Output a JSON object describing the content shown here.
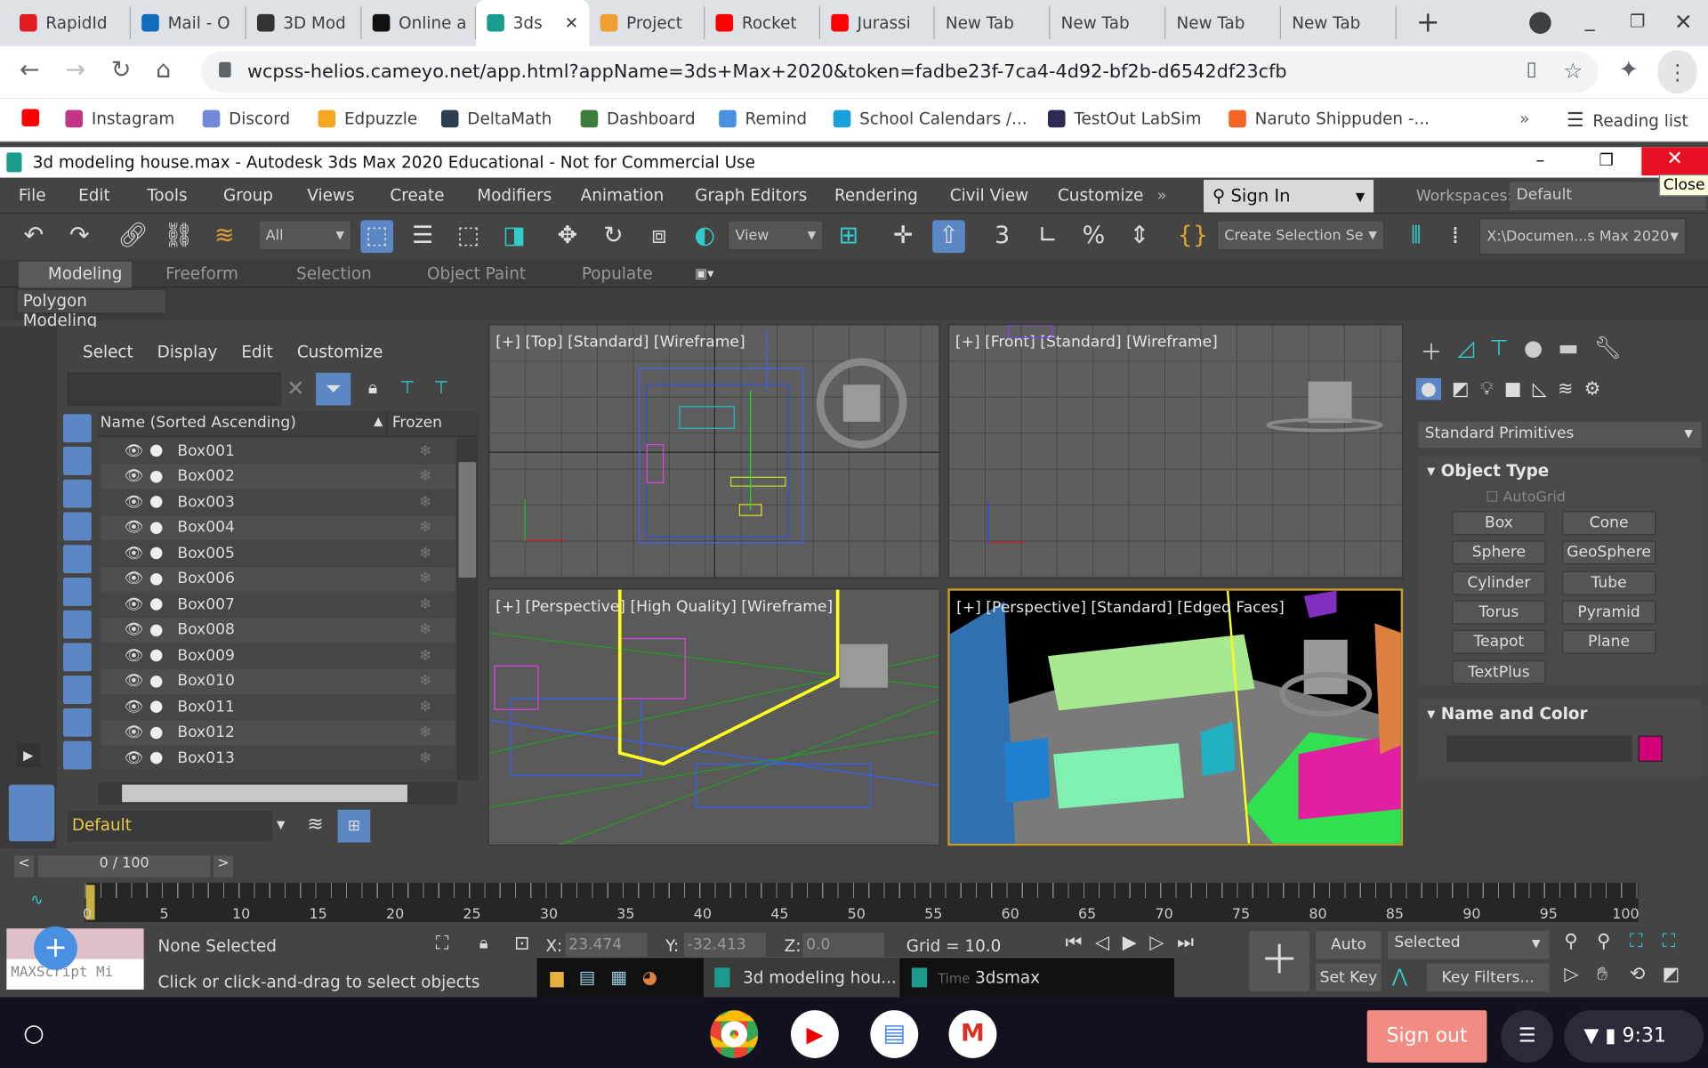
{
  "browser": {
    "tabs": [
      {
        "label": "RapidId",
        "color": "#e01b22"
      },
      {
        "label": "Mail - O",
        "color": "#0f6cbd"
      },
      {
        "label": "3D Mod",
        "color": "#333"
      },
      {
        "label": "Online a",
        "color": "#111"
      },
      {
        "label": "3ds",
        "color": "#1a9c8c",
        "active": true
      },
      {
        "label": "Project",
        "color": "#f0a030"
      },
      {
        "label": "Rocket",
        "color": "#ff0000"
      },
      {
        "label": "Jurassi",
        "color": "#ff0000"
      },
      {
        "label": "New Tab"
      },
      {
        "label": "New Tab"
      },
      {
        "label": "New Tab"
      },
      {
        "label": "New Tab"
      }
    ],
    "url": "wcpss-helios.cameyo.net/app.html?appName=3ds+Max+2020&token=fadbe23f-7ca4-4d92-bf2b-d6542df23cfb",
    "bookmarks": [
      {
        "label": "",
        "color": "#ff0000"
      },
      {
        "label": "Instagram",
        "color": "#c13584"
      },
      {
        "label": "Discord",
        "color": "#7289da"
      },
      {
        "label": "Edpuzzle",
        "color": "#f5a623"
      },
      {
        "label": "DeltaMath",
        "color": "#2c3e50"
      },
      {
        "label": "Dashboard",
        "color": "#3b7d3b"
      },
      {
        "label": "Remind",
        "color": "#4a90e2"
      },
      {
        "label": "School Calendars /...",
        "color": "#1aa0d8"
      },
      {
        "label": "TestOut LabSim",
        "color": "#2c2c54"
      },
      {
        "label": "Naruto Shippuden -...",
        "color": "#f26522"
      }
    ],
    "overflow": "»",
    "reading_list": "Reading list"
  },
  "app": {
    "title": "3d modeling house.max - Autodesk 3ds Max 2020 Educational - Not for Commercial Use",
    "close_tooltip": "Close",
    "menu": [
      "File",
      "Edit",
      "Tools",
      "Group",
      "Views",
      "Create",
      "Modifiers",
      "Animation",
      "Graph Editors",
      "Rendering",
      "Civil View",
      "Customize"
    ],
    "sign_in": "Sign In",
    "workspaces_label": "Workspaces:",
    "workspace": "Default",
    "toolbar": {
      "filter": "All",
      "refcoord": "View",
      "selection_set": "Create Selection Se",
      "path": "X:\\Documen...s Max 2020"
    },
    "ribbon_tabs": [
      "Modeling",
      "Freeform",
      "Selection",
      "Object Paint",
      "Populate"
    ],
    "ribbon_sub": "Polygon Modeling",
    "explorer": {
      "menu": [
        "Select",
        "Display",
        "Edit",
        "Customize"
      ],
      "col_name": "Name (Sorted Ascending)",
      "col_frozen": "Frozen",
      "rows": [
        "Box001",
        "Box002",
        "Box003",
        "Box004",
        "Box005",
        "Box006",
        "Box007",
        "Box008",
        "Box009",
        "Box010",
        "Box011",
        "Box012",
        "Box013"
      ],
      "layer": "Default"
    },
    "viewports": [
      "[+] [Top] [Standard] [Wireframe]",
      "[+] [Front] [Standard] [Wireframe]",
      "[+] [Perspective] [High Quality] [Wireframe]",
      "[+] [Perspective] [Standard] [Edged Faces]"
    ],
    "command": {
      "category": "Standard Primitives",
      "object_type": "Object Type",
      "autogrid": "AutoGrid",
      "buttons": [
        "Box",
        "Cone",
        "Sphere",
        "GeoSphere",
        "Cylinder",
        "Tube",
        "Torus",
        "Pyramid",
        "Teapot",
        "Plane",
        "TextPlus"
      ],
      "name_color": "Name and Color",
      "swatch": "#d4007a"
    },
    "time": {
      "frame": "0 / 100",
      "ticks": [
        "0",
        "5",
        "10",
        "15",
        "20",
        "25",
        "30",
        "35",
        "40",
        "45",
        "50",
        "55",
        "60",
        "65",
        "70",
        "75",
        "80",
        "85",
        "90",
        "95",
        "100"
      ]
    },
    "status": {
      "selected": "None Selected",
      "prompt": "Click or click-and-drag to select objects",
      "maxscript": "MAXScript Mi",
      "x_label": "X:",
      "x": "23.474",
      "y_label": "Y:",
      "y": "-32.413",
      "z_label": "Z:",
      "z": "0.0",
      "grid": "Grid = 10.0",
      "auto_key": "Auto Key",
      "set_key": "Set Key",
      "key_mode": "Selected",
      "key_filters": "Key Filters..."
    },
    "taskbar": {
      "item1": "3d modeling hou...",
      "item2": "3dsmax",
      "time_label": "Time"
    }
  },
  "shelf": {
    "sign_out": "Sign out",
    "clock": "9:31"
  }
}
